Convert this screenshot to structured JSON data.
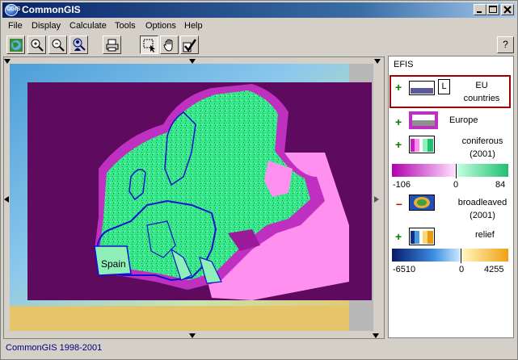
{
  "window": {
    "title": "CommonGIS",
    "logo_text": "CGIS",
    "controls": [
      "minimize-icon",
      "maximize-icon",
      "close-icon"
    ]
  },
  "menu": [
    "File",
    "Display",
    "Calculate",
    "Tools",
    "Options",
    "Help"
  ],
  "toolbar": {
    "buttons": [
      "globe-icon",
      "zoom-in-icon",
      "zoom-out-icon",
      "zoom-person-icon",
      "print-icon",
      "select-rect-icon",
      "pan-hand-icon",
      "check-icon"
    ]
  },
  "help_button": "?",
  "map": {
    "label_spain": "Spain",
    "colors": {
      "background_purple": "#5e0a5e",
      "ocean": "#6eb0e0",
      "land_green": "#36e88a",
      "magenta": "#c030c0",
      "pink": "#ff90f0",
      "border_blue": "#1010d0"
    }
  },
  "legend": {
    "title": "EFIS",
    "layers": [
      {
        "name": "EU countries",
        "lines": [
          "EU",
          "countries"
        ],
        "toggle": "plus",
        "badge": "L"
      },
      {
        "name": "Europe",
        "lines": [
          "Europe"
        ],
        "toggle": "plus"
      },
      {
        "name": "coniferous (2001)",
        "lines": [
          "coniferous",
          "(2001)"
        ],
        "toggle": "plus",
        "scale": {
          "min": "-106",
          "mid": "0",
          "max": "84"
        }
      },
      {
        "name": "broadleaved (2001)",
        "lines": [
          "broadleaved",
          "(2001)"
        ],
        "toggle": "minus"
      },
      {
        "name": "relief",
        "lines": [
          "relief"
        ],
        "toggle": "plus",
        "scale": {
          "min": "-6510",
          "mid": "0",
          "max": "4255"
        }
      }
    ]
  },
  "status": "CommonGIS 1998-2001"
}
